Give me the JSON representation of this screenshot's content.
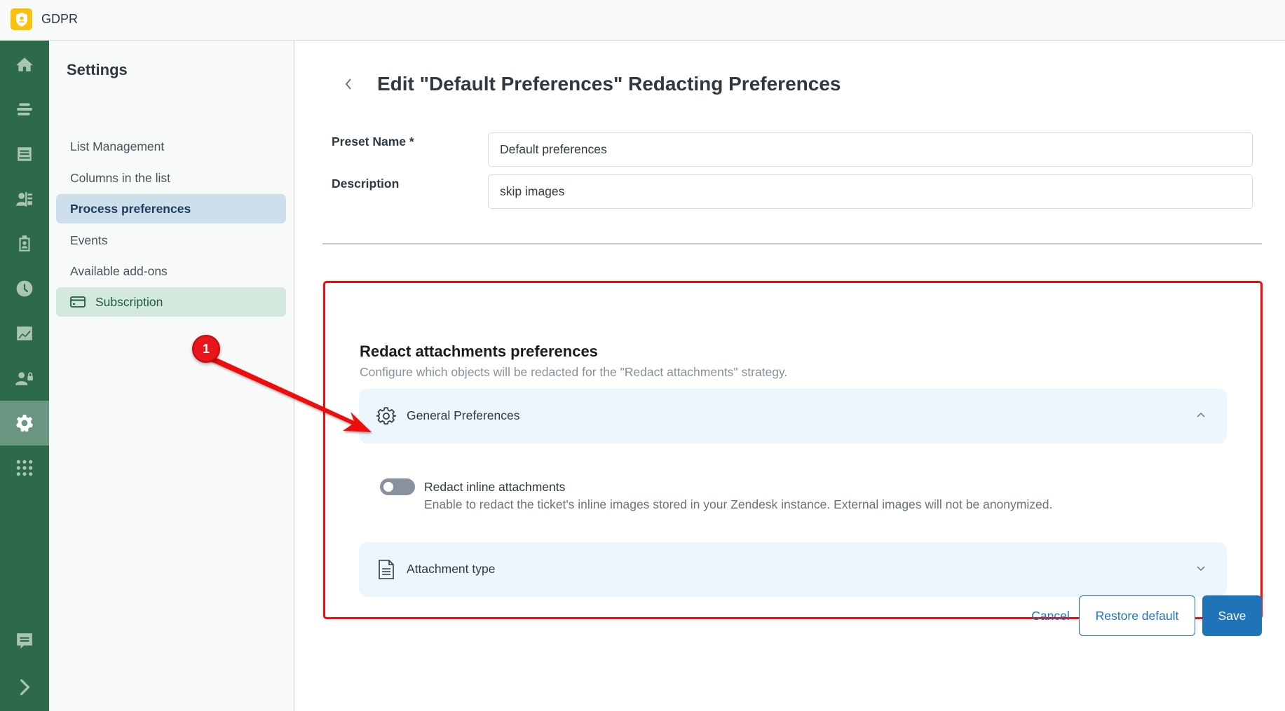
{
  "app": {
    "title": "GDPR",
    "logo_icon": "shield-user-icon",
    "logo_color": "#f9c10c"
  },
  "rail": {
    "background": "#2d6a4a",
    "items": [
      {
        "icon": "home-icon",
        "active": false
      },
      {
        "icon": "list-icon",
        "active": false
      },
      {
        "icon": "inbox-icon",
        "active": false
      },
      {
        "icon": "contacts-icon",
        "active": false
      },
      {
        "icon": "badge-icon",
        "active": false
      },
      {
        "icon": "clock-icon",
        "active": false
      },
      {
        "icon": "chart-icon",
        "active": false
      },
      {
        "icon": "user-lock-icon",
        "active": false
      },
      {
        "icon": "gear-icon",
        "active": true
      },
      {
        "icon": "apps-grid-icon",
        "active": false
      }
    ],
    "bottom_items": [
      {
        "icon": "chat-icon"
      },
      {
        "icon": "chevron-right-icon"
      }
    ]
  },
  "settings": {
    "title": "Settings",
    "items": [
      {
        "label": "List Management",
        "active": false
      },
      {
        "label": "Columns in the list",
        "active": false
      },
      {
        "label": "Process preferences",
        "active": true
      },
      {
        "label": "Events",
        "active": false
      },
      {
        "label": "Available add-ons",
        "active": false
      },
      {
        "label": "Subscription",
        "active": false,
        "icon": "credit-card-icon"
      }
    ]
  },
  "page": {
    "title": "Edit \"Default Preferences\" Redacting Preferences",
    "back_icon": "chevron-left-icon"
  },
  "form": {
    "preset_name_label": "Preset Name *",
    "preset_name_value": "Default preferences",
    "description_label": "Description",
    "description_value": "skip images"
  },
  "section": {
    "heading": "Redact attachments preferences",
    "subtitle": "Configure which objects will be redacted for the \"Redact attachments\" strategy.",
    "accordions": [
      {
        "label": "General Preferences",
        "icon": "gear-outline-icon",
        "expanded": true
      },
      {
        "label": "Attachment type",
        "icon": "document-icon",
        "expanded": false
      }
    ],
    "toggle": {
      "label": "Redact inline attachments",
      "hint": "Enable to redact the ticket's inline images stored in your Zendesk instance. External images will not be anonymized.",
      "checked": false
    }
  },
  "actions": {
    "cancel_label": "Cancel",
    "restore_label": "Restore default",
    "save_label": "Save",
    "primary_color": "#1f73b7"
  },
  "annotation": {
    "badge_number": "1",
    "color": "#e8161b"
  }
}
